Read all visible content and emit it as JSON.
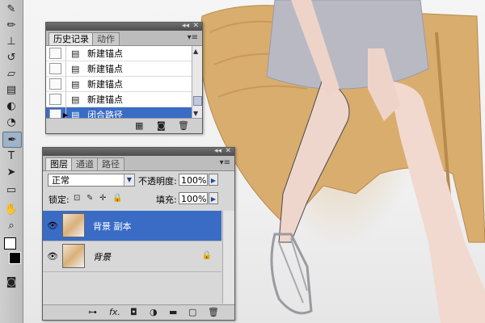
{
  "history_panel": {
    "tabs": [
      "历史记录",
      "动作"
    ],
    "active_tab": 0,
    "items": [
      {
        "label": "新建锚点",
        "selected": false
      },
      {
        "label": "新建锚点",
        "selected": false
      },
      {
        "label": "新建锚点",
        "selected": false
      },
      {
        "label": "新建锚点",
        "selected": false
      },
      {
        "label": "闭合路径",
        "selected": true
      }
    ],
    "footer_icons": [
      "new-snapshot-icon",
      "camera-icon",
      "trash-icon"
    ]
  },
  "layers_panel": {
    "tabs": [
      "图层",
      "通道",
      "路径"
    ],
    "active_tab": 0,
    "blend_mode": "正常",
    "opacity_label": "不透明度:",
    "opacity_value": "100%",
    "lock_label": "锁定:",
    "fill_label": "填充:",
    "fill_value": "100%",
    "layers": [
      {
        "name": "背景 副本",
        "selected": true,
        "locked": false
      },
      {
        "name": "背景",
        "selected": false,
        "locked": true
      }
    ],
    "footer_icons": [
      "link-icon",
      "fx-icon",
      "mask-icon",
      "adjustment-icon",
      "group-icon",
      "new-layer-icon",
      "trash-icon"
    ],
    "footer_fx": "fx."
  },
  "toolbar": {
    "tools": [
      "brush-icon",
      "pencil-icon",
      "stamp-icon",
      "history-brush-icon",
      "eraser-icon",
      "gradient-icon",
      "dodge-icon",
      "burn-icon",
      "pen-icon",
      "type-icon",
      "path-select-icon",
      "shape-icon",
      "hand-icon",
      "zoom-icon",
      "color-swatch-icon",
      "quickmask-icon"
    ],
    "type_glyph": "T"
  },
  "colors": {
    "selection": "#3a6cc6",
    "panel_bg": "#d6d6d6"
  }
}
